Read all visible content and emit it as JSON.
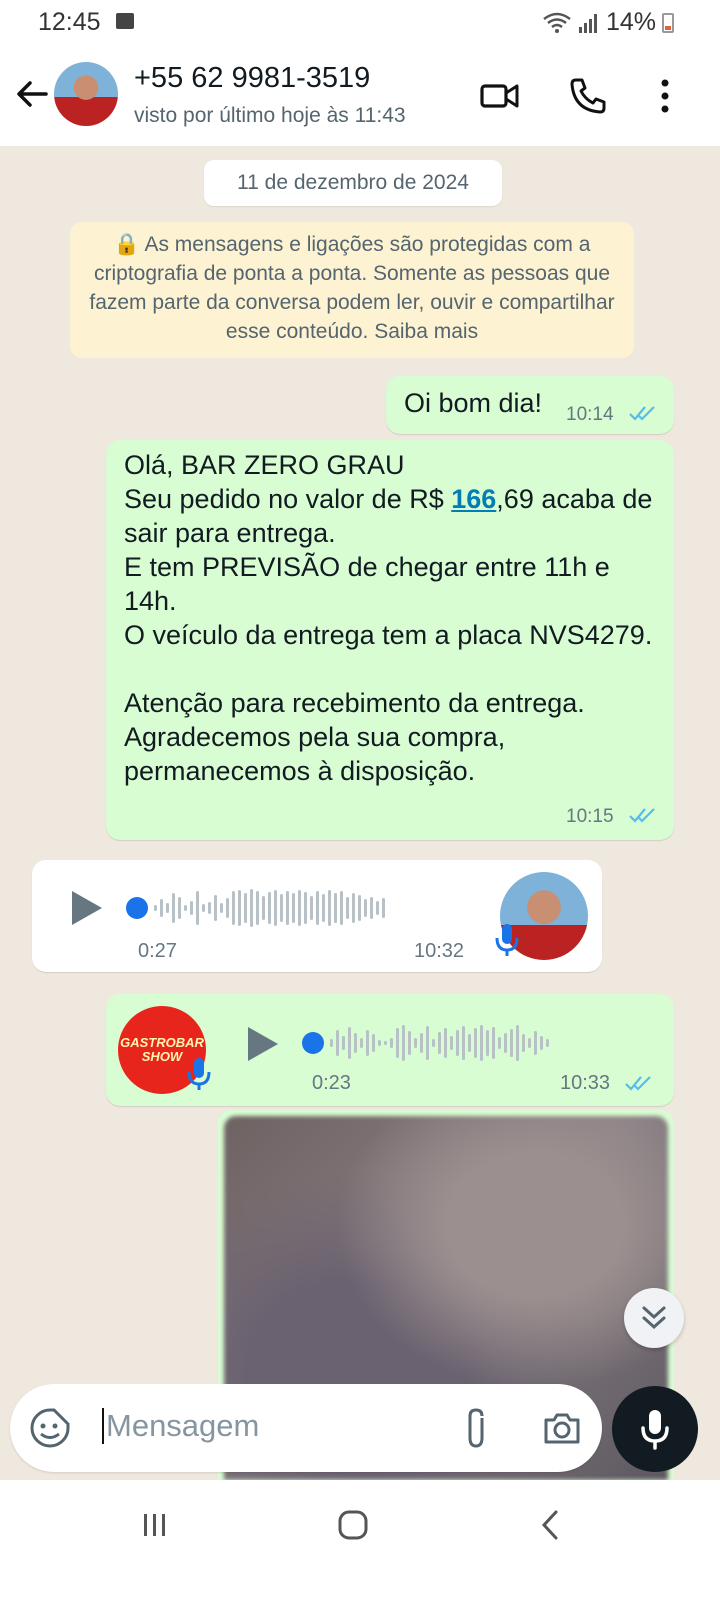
{
  "status_bar": {
    "time": "12:45",
    "battery": "14%"
  },
  "header": {
    "contact_name": "+55 62 9981-3519",
    "last_seen": "visto por último hoje às 11:43",
    "icons": [
      "back-arrow-icon",
      "video-call-icon",
      "phone-call-icon",
      "more-vert-icon"
    ]
  },
  "chat": {
    "date_chip": "11 de dezembro de 2024",
    "encryption_notice": "🔒 As mensagens e ligações são protegidas com a criptografia de ponta a ponta. Somente as pessoas que fazem parte da conversa podem ler, ouvir e compartilhar esse conteúdo. Saiba mais",
    "messages": [
      {
        "direction": "out",
        "type": "text",
        "text": "Oi bom dia!",
        "time": "10:14",
        "status": "read"
      },
      {
        "direction": "out",
        "type": "text",
        "line1": "Olá, BAR ZERO GRAU",
        "line2_pre": "Seu pedido no valor de R$ ",
        "line2_link": "166",
        "line2_post": ",69 acaba de sair para entrega.",
        "rest": "E tem PREVISÃO de chegar entre 11h e 14h.\nO veículo da entrega tem a placa NVS4279.\n\nAtenção para recebimento da entrega.\nAgradecemos pela sua compra, permanecemos à disposição.",
        "time": "10:15",
        "status": "read"
      },
      {
        "direction": "in",
        "type": "voice",
        "duration": "0:27",
        "time": "10:32"
      },
      {
        "direction": "out",
        "type": "voice",
        "avatar_text": "GASTROBAR SHOW",
        "duration": "0:23",
        "time": "10:33",
        "status": "read"
      },
      {
        "direction": "out",
        "type": "image"
      }
    ]
  },
  "composer": {
    "placeholder": "Mensagem",
    "icons": [
      "sticker-icon",
      "attach-icon",
      "camera-icon",
      "mic-icon"
    ]
  },
  "colors": {
    "bubble_out": "#d9fdd3",
    "bubble_in": "#ffffff",
    "chat_bg": "#efe8de",
    "read_tick": "#53bdeb",
    "link": "#027eb5"
  }
}
